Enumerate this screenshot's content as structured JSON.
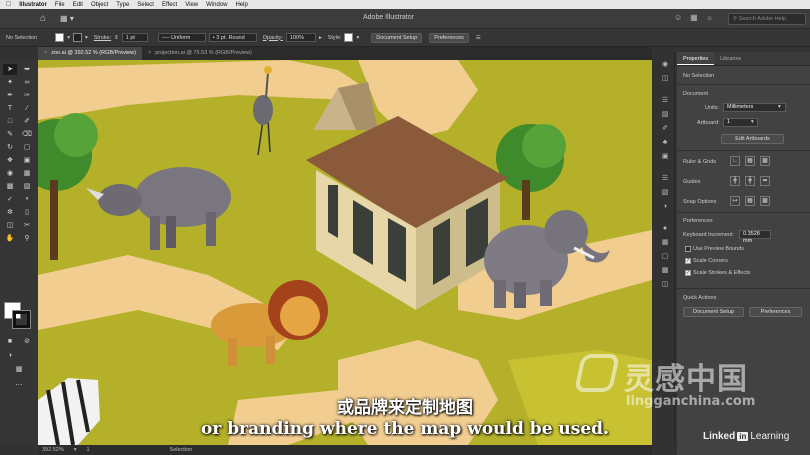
{
  "menubar": {
    "apple": "",
    "items": [
      "Illustrator",
      "File",
      "Edit",
      "Object",
      "Type",
      "Select",
      "Effect",
      "View",
      "Window",
      "Help"
    ]
  },
  "appbar": {
    "title": "Adobe Illustrator",
    "search_placeholder": "Search Adobe Help"
  },
  "controlbar": {
    "selection": "No Selection",
    "stroke_label": "Stroke:",
    "stroke_weight": "1 pt",
    "profile": "Uniform",
    "brush": "3 pt. Round",
    "opacity_label": "Opacity:",
    "opacity_value": "100%",
    "style_label": "Style:",
    "document_setup": "Document Setup",
    "preferences": "Preferences"
  },
  "tabs": [
    {
      "label": "zoo.ai @ 392.52 % (RGB/Preview)",
      "active": true
    },
    {
      "label": "projection.ai @ 75.53 % (RGB/Preview)",
      "active": false
    }
  ],
  "statusbar": {
    "zoom": "392.52%",
    "artboard": "1",
    "mode": "Selection"
  },
  "panel": {
    "tabs": [
      "Properties",
      "Libraries"
    ],
    "no_selection": "No Selection",
    "document": "Document",
    "units_label": "Units:",
    "units_value": "Millimeters",
    "artboard_label": "Artboard:",
    "artboard_value": "1",
    "edit_artboards": "Edit Artboards",
    "ruler_grids": "Ruler & Grids",
    "guides": "Guides",
    "snap_options": "Snap Options",
    "preferences": "Preferences",
    "keyboard_increment_label": "Keyboard Increment:",
    "keyboard_increment_value": "0.3528 mm",
    "use_preview_bounds": "Use Preview Bounds",
    "scale_corners": "Scale Corners",
    "scale_strokes": "Scale Strokes & Effects",
    "quick_actions": "Quick Actions",
    "doc_setup_btn": "Document Setup",
    "prefs_btn": "Preferences"
  },
  "subtitles": {
    "cn": "或品牌来定制地图",
    "en": "or branding where the map would be used."
  },
  "watermark": {
    "cn": "灵感中国",
    "url": "lingganchina.com",
    "linkedin_a": "Linked",
    "linkedin_in": "in",
    "linkedin_b": "Learning"
  },
  "colors": {
    "grass": "#b7b22a",
    "path": "#f3cf8e",
    "panel_bg": "#424242",
    "accent_white": "#ffffff"
  }
}
